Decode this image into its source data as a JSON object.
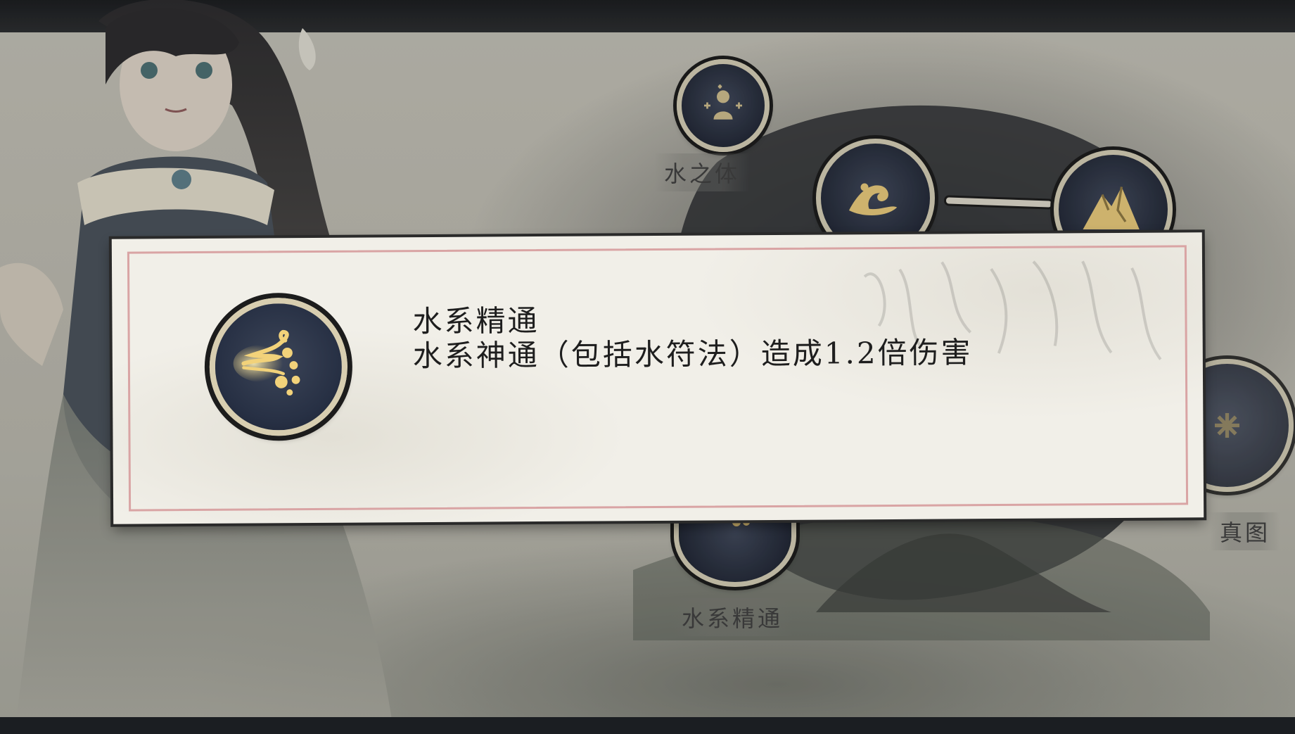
{
  "skill_tree": {
    "nodes": [
      {
        "label": "水之体",
        "icon": "body-plus-icon"
      },
      {
        "label": "",
        "icon": "wave-icon"
      },
      {
        "label": "",
        "icon": "mountain-icon"
      },
      {
        "label": "",
        "icon": "snowflake-icon"
      },
      {
        "label": "水系精通",
        "icon": "water-swirl-icon"
      }
    ],
    "partial_labels": {
      "right_node": "真图"
    }
  },
  "popup": {
    "title": "水系精通",
    "description": "水系神通（包括水符法）造成1.2倍伤害",
    "icon": "water-swirl-icon"
  },
  "colors": {
    "paper": "#f1efe8",
    "frame_red": "#d9a4a4",
    "icon_gold": "#f2d27a",
    "node_blue": "#273044"
  }
}
